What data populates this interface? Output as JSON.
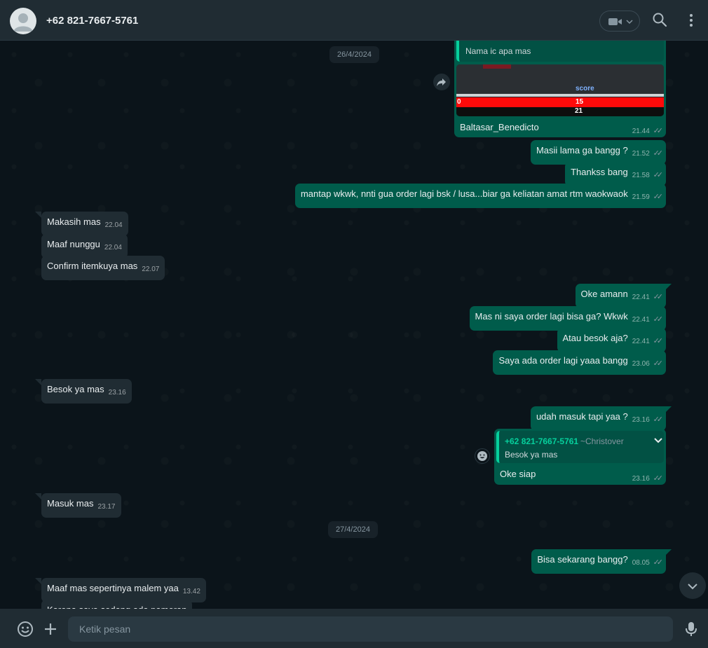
{
  "header": {
    "contact_name": "+62 821-7667-5761",
    "icons": [
      "avatar-icon",
      "video-call-icon",
      "search-icon",
      "menu-icon"
    ]
  },
  "chat": {
    "date_1": "26/4/2024",
    "date_2": "27/4/2024",
    "image_message": {
      "quoted_text": "Nama ic apa mas",
      "screenshot_text": {
        "score_label": "score",
        "left_value": "0",
        "bar_value": "15",
        "bottom_value": "21"
      },
      "caption": "Baltasar_Benedicto",
      "time": "21.44"
    },
    "messages": [
      {
        "dir": "out",
        "text": "Masii lama ga bangg ?",
        "time": "21.52"
      },
      {
        "dir": "out",
        "text": "Thankss bang",
        "time": "21.58"
      },
      {
        "dir": "out",
        "text": "mantap wkwk, nnti gua order lagi bsk / lusa...biar ga keliatan amat rtm waokwaok",
        "time": "21.59"
      },
      {
        "dir": "in",
        "text": "Makasih mas",
        "time": "22.04"
      },
      {
        "dir": "in",
        "text": "Maaf nunggu",
        "time": "22.04"
      },
      {
        "dir": "in",
        "text": "Confirm itemkuya mas",
        "time": "22.07"
      },
      {
        "dir": "out",
        "text": "Oke amann",
        "time": "22.41"
      },
      {
        "dir": "out",
        "text": "Mas ni saya order lagi bisa ga? Wkwk",
        "time": "22.41"
      },
      {
        "dir": "out",
        "text": "Atau besok aja?",
        "time": "22.41"
      },
      {
        "dir": "out",
        "text": "Saya ada order lagi yaaa bangg",
        "time": "23.06"
      },
      {
        "dir": "in",
        "text": "Besok ya mas",
        "time": "23.16"
      },
      {
        "dir": "out",
        "text": "udah masuk tapi yaa ?",
        "time": "23.16"
      },
      {
        "dir": "in",
        "text": "Masuk mas",
        "time": "23.17"
      },
      {
        "dir": "out",
        "text": "Bisa sekarang bangg?",
        "time": "08.05"
      },
      {
        "dir": "in",
        "text": "Maaf mas sepertinya malem yaa",
        "time": "13.42"
      },
      {
        "dir": "in",
        "text": "Karena saya sedang ada pameran",
        "time": ""
      }
    ],
    "reply_message": {
      "quoted_name": "+62 821-7667-5761",
      "quoted_alias": "~Christover",
      "quoted_text": "Besok ya mas",
      "text": "Oke siap",
      "time": "23.16"
    },
    "read_ticks": "✓✓"
  },
  "footer": {
    "input_placeholder": "Ketik pesan",
    "input_value": ""
  },
  "colors": {
    "background": "#0b141a",
    "header": "#202c33",
    "outgoing_bubble": "#005c4b",
    "incoming_bubble": "#202c33",
    "accent": "#06cf9c"
  }
}
